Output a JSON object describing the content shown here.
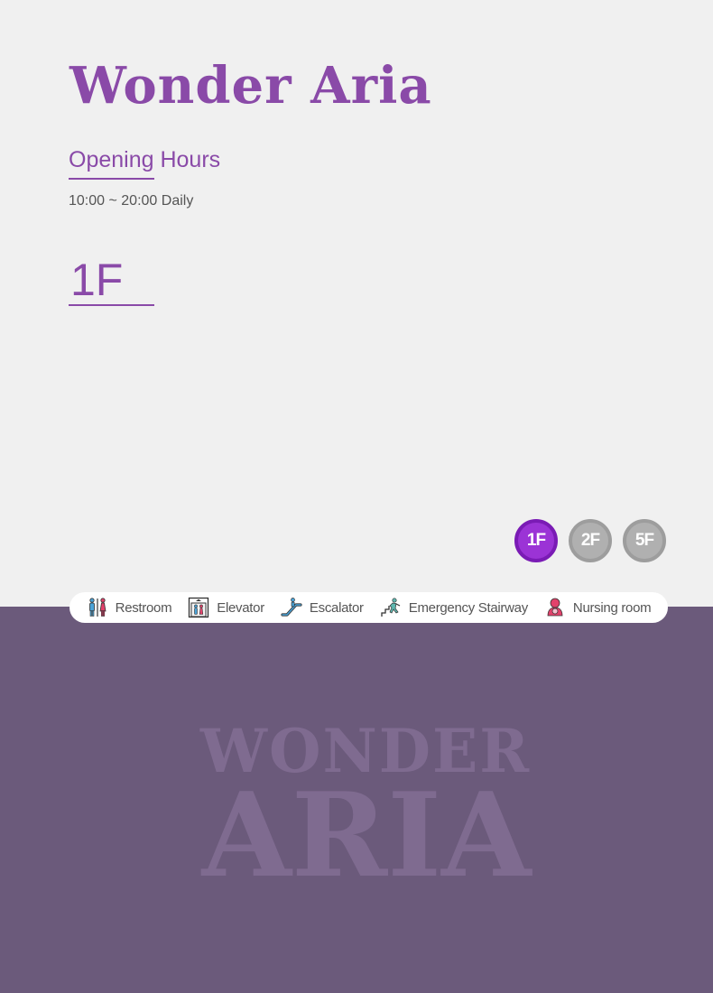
{
  "header": {
    "title": "Wonder Aria"
  },
  "hours": {
    "heading": "Opening Hours",
    "text": "10:00 ~ 20:00 Daily"
  },
  "floor": {
    "current": "1F"
  },
  "floor_buttons": [
    {
      "label": "1F",
      "active": true
    },
    {
      "label": "2F",
      "active": false
    },
    {
      "label": "5F",
      "active": false
    }
  ],
  "legend": {
    "items": [
      {
        "label": "Restroom",
        "icon": "restroom-icon"
      },
      {
        "label": "Elevator",
        "icon": "elevator-icon"
      },
      {
        "label": "Escalator",
        "icon": "escalator-icon"
      },
      {
        "label": "Emergency Stairway",
        "icon": "emergency-stairway-icon"
      },
      {
        "label": "Nursing room",
        "icon": "nursing-room-icon"
      }
    ]
  },
  "watermark": {
    "line1": "WONDER",
    "line2": "ARIA"
  },
  "colors": {
    "brand": "#8a4aa8",
    "active_floor": "#9b33d6",
    "inactive_floor": "#b0b0b0",
    "bottom_panel": "#6b5a7b",
    "watermark": "#7f6b90"
  }
}
